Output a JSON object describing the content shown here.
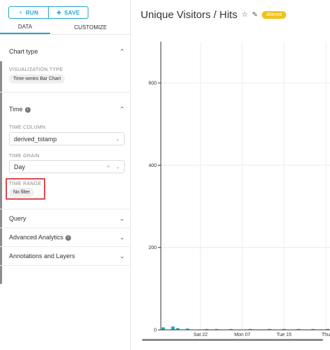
{
  "toolbar": {
    "run_label": "RUN",
    "save_label": "SAVE"
  },
  "tabs": [
    {
      "label": "DATA",
      "active": true
    },
    {
      "label": "CUSTOMIZE",
      "active": false
    }
  ],
  "sections": {
    "chart_type": {
      "title": "Chart type",
      "viz_label": "VISUALIZATION TYPE",
      "viz_value": "Time-series Bar Chart"
    },
    "time": {
      "title": "Time",
      "time_column_label": "TIME COLUMN",
      "time_column_value": "derived_tstamp",
      "time_grain_label": "TIME GRAIN",
      "time_grain_value": "Day",
      "time_range_label": "TIME RANGE",
      "time_range_value": "No filter"
    },
    "query": {
      "title": "Query"
    },
    "advanced_analytics": {
      "title": "Advanced Analytics"
    },
    "annotations": {
      "title": "Annotations and Layers"
    }
  },
  "header": {
    "title": "Unique Visitors / Hits",
    "badge": "Altered"
  },
  "colors": {
    "accent": "#20a7c9",
    "badge": "#f0c11a",
    "bar": "#20a7c9",
    "highlight": "#e04a4a"
  },
  "chart_data": {
    "type": "bar",
    "ylim": [
      0,
      700
    ],
    "yticks": [
      0,
      200,
      400,
      600
    ],
    "xticks": [
      "Sat 22",
      "Mon 07",
      "Tue 15",
      "Thu"
    ],
    "values": [
      6,
      0,
      8,
      4,
      0,
      3,
      0,
      0,
      0,
      2,
      0,
      2,
      0,
      0,
      2,
      0,
      0,
      0,
      2,
      0,
      0,
      0,
      2,
      0,
      0,
      2,
      0,
      0,
      2,
      0,
      0,
      2,
      0,
      0,
      2
    ]
  }
}
